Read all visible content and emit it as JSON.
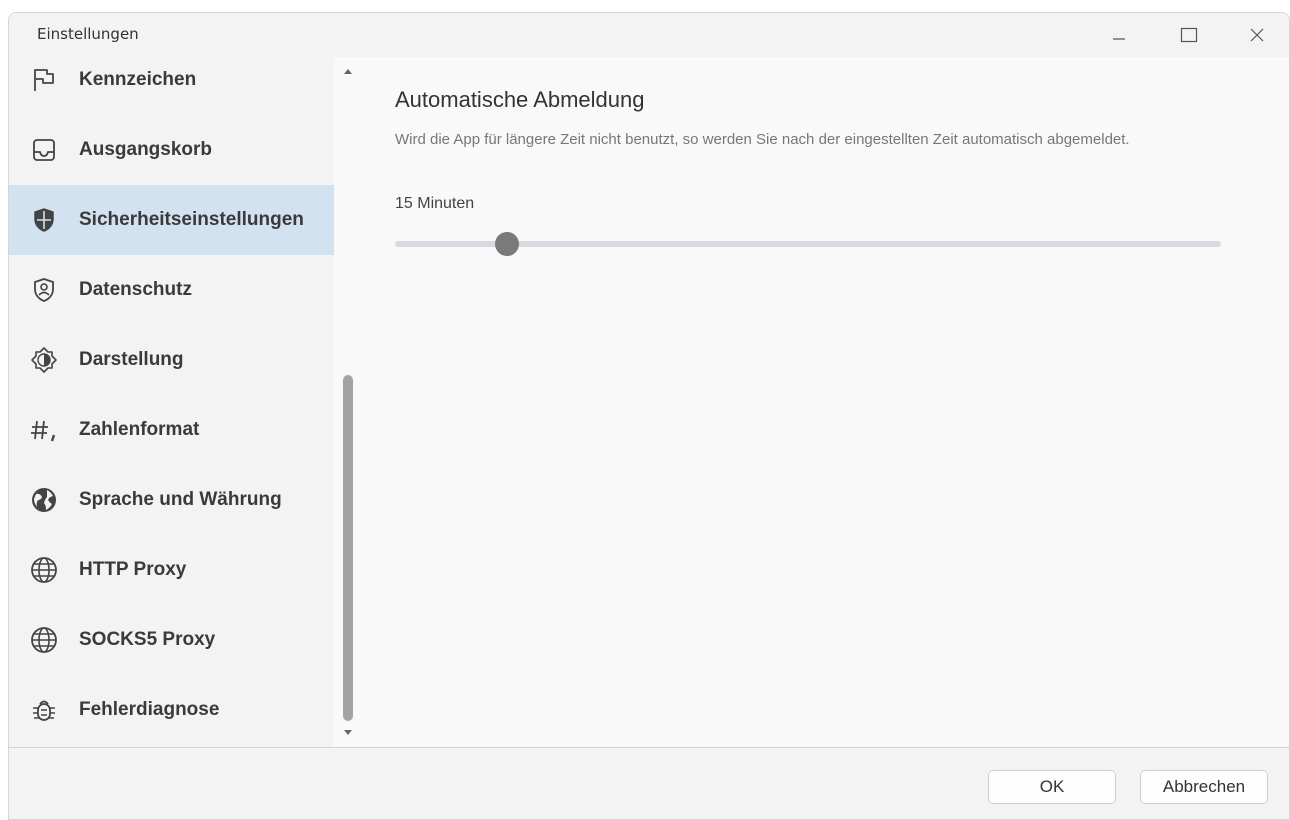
{
  "window": {
    "title": "Einstellungen"
  },
  "sidebar": {
    "items": [
      {
        "label": "Kennzeichen",
        "icon": "flag-icon"
      },
      {
        "label": "Ausgangskorb",
        "icon": "inbox-tray-icon"
      },
      {
        "label": "Sicherheitseinstellungen",
        "icon": "shield-icon",
        "selected": true
      },
      {
        "label": "Datenschutz",
        "icon": "privacy-shield-user-icon"
      },
      {
        "label": "Darstellung",
        "icon": "brightness-icon"
      },
      {
        "label": "Zahlenformat",
        "icon": "number-format-icon"
      },
      {
        "label": "Sprache und Währung",
        "icon": "globe-icon"
      },
      {
        "label": "HTTP Proxy",
        "icon": "globe-grid-icon"
      },
      {
        "label": "SOCKS5 Proxy",
        "icon": "globe-grid-icon"
      },
      {
        "label": "Fehlerdiagnose",
        "icon": "bug-icon"
      }
    ]
  },
  "main": {
    "title": "Automatische Abmeldung",
    "description": "Wird die App für längere Zeit nicht benutzt, so werden Sie nach der eingestellten Zeit automatisch abgemeldet.",
    "slider": {
      "value_label": "15 Minuten",
      "position_fraction": 0.135
    }
  },
  "footer": {
    "ok_label": "OK",
    "cancel_label": "Abbrechen"
  },
  "colors": {
    "selected_bg": "#d3e2f1",
    "slider_thumb": "#7a7a7a",
    "slider_track": "#d6d9dd"
  }
}
